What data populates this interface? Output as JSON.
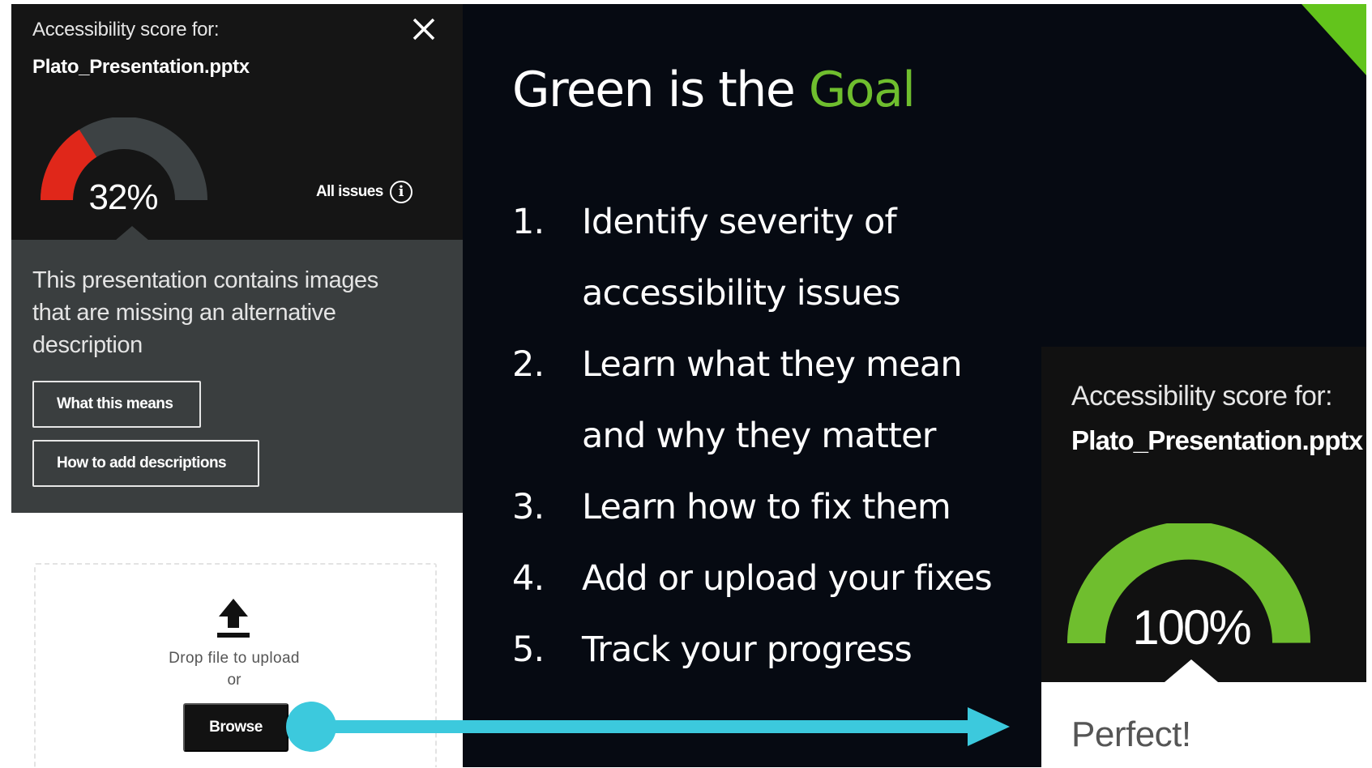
{
  "left_panel": {
    "score_label": "Accessibility score for:",
    "file_name": "Plato_Presentation.pptx",
    "score_percent": "32%",
    "score_value": 0.32,
    "all_issues_label": "All issues",
    "info_icon": "info-icon",
    "close_icon": "close-icon",
    "message": "This presentation contains images that are missing an alternative description",
    "what_this_means_label": "What this means",
    "how_to_add_label": "How to add descriptions",
    "upload_icon": "upload-icon",
    "drop_text": "Drop file to upload",
    "or_text": "or",
    "browse_label": "Browse"
  },
  "slide": {
    "title_prefix": "Green is the ",
    "title_highlight": "Goal",
    "items": [
      {
        "num": "1.",
        "line1": "Identify severity of",
        "line2": "accessibility issues"
      },
      {
        "num": "2.",
        "line1": "Learn what they mean",
        "line2": "and why they matter"
      },
      {
        "num": "3.",
        "line1": "Learn how to fix them"
      },
      {
        "num": "4.",
        "line1": "Add or upload your fixes"
      },
      {
        "num": "5.",
        "line1": "Track your progress"
      }
    ]
  },
  "right_panel": {
    "score_label": "Accessibility score for:",
    "file_name": "Plato_Presentation.pptx",
    "score_percent": "100%",
    "score_value": 1.0,
    "status": "Perfect!"
  },
  "colors": {
    "slide_bg": "#060a12",
    "accent_green": "#6fbe2e",
    "gauge_red": "#e0271a",
    "gauge_track": "#3d4244",
    "arrow_cyan": "#3cc9dd"
  }
}
